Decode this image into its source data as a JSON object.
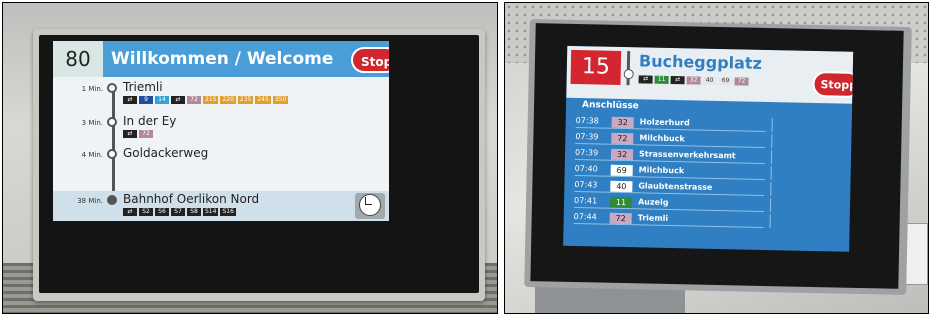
{
  "left_display": {
    "line_number": "80",
    "header_text": "Willkommen / Welcome",
    "stop_request": "Stopp",
    "stops": [
      {
        "minutes": "1 Min.",
        "name": "Triemli",
        "badges": [
          {
            "text": "⇄",
            "color": "#222"
          },
          {
            "text": "9",
            "color": "#1e4fa0"
          },
          {
            "text": "14",
            "color": "#2fa4d8"
          },
          {
            "text": "⇄",
            "color": "#222"
          },
          {
            "text": "72",
            "color": "#b18a9a"
          },
          {
            "text": "215",
            "color": "#e0a030"
          },
          {
            "text": "220",
            "color": "#e0a030"
          },
          {
            "text": "235",
            "color": "#e0a030"
          },
          {
            "text": "245",
            "color": "#e0a030"
          },
          {
            "text": "350",
            "color": "#e0a030"
          }
        ]
      },
      {
        "minutes": "3 Min.",
        "name": "In der Ey",
        "badges": [
          {
            "text": "⇄",
            "color": "#222"
          },
          {
            "text": "72",
            "color": "#b18a9a"
          }
        ]
      },
      {
        "minutes": "4 Min.",
        "name": "Goldackerweg",
        "badges": []
      },
      {
        "minutes": "38 Min.",
        "name": "Bahnhof Oerlikon Nord",
        "badges": [
          {
            "text": "⇄",
            "color": "#222"
          },
          {
            "text": "S2",
            "color": "#222"
          },
          {
            "text": "S6",
            "color": "#222"
          },
          {
            "text": "S7",
            "color": "#222"
          },
          {
            "text": "S8",
            "color": "#222"
          },
          {
            "text": "S14",
            "color": "#222"
          },
          {
            "text": "S16",
            "color": "#222"
          }
        ]
      }
    ]
  },
  "right_display": {
    "line_number": "15",
    "destination": "Bucheggplatz",
    "stop_request": "Stopp",
    "section_title": "Anschlüsse",
    "badges": [
      {
        "text": "⇄",
        "color": "#222"
      },
      {
        "text": "11",
        "color": "#2e8b3a"
      },
      {
        "text": "⇄",
        "color": "#222"
      },
      {
        "text": "32",
        "color": "#b18a9a"
      },
      {
        "text": "40",
        "color": "#e6e6e6"
      },
      {
        "text": "69",
        "color": "#e6e6e6"
      },
      {
        "text": "72",
        "color": "#b18a9a"
      }
    ],
    "connections": [
      {
        "time": "07:38",
        "line": "32",
        "line_color": "#c9a9c2",
        "stop": "Holzerhurd"
      },
      {
        "time": "07:39",
        "line": "72",
        "line_color": "#c9a9c2",
        "stop": "Milchbuck"
      },
      {
        "time": "07:39",
        "line": "32",
        "line_color": "#c9a9c2",
        "stop": "Strassenverkehrsamt"
      },
      {
        "time": "07:40",
        "line": "69",
        "line_color": "#ffffff",
        "stop": "Milchbuck"
      },
      {
        "time": "07:43",
        "line": "40",
        "line_color": "#ffffff",
        "stop": "Glaubtenstrasse"
      },
      {
        "time": "07:41",
        "line": "11",
        "line_color": "#2e8b3a",
        "stop": "Auzelg"
      },
      {
        "time": "07:44",
        "line": "72",
        "line_color": "#c9a9c2",
        "stop": "Triemli"
      }
    ]
  }
}
